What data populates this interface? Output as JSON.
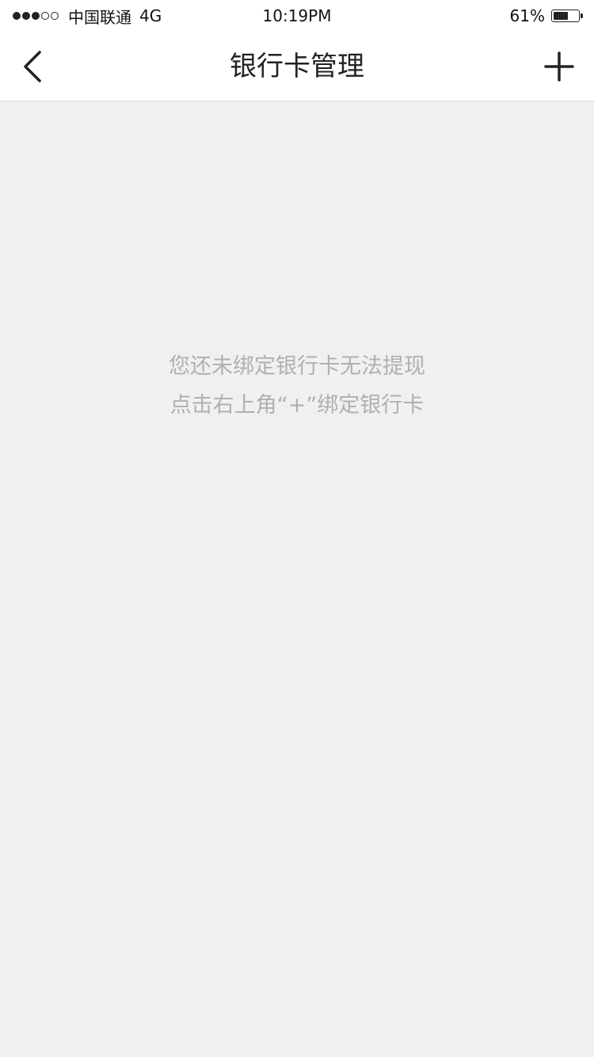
{
  "status_bar": {
    "signal_filled": 3,
    "signal_total": 5,
    "carrier": "中国联通",
    "network": "4G",
    "time": "10:19PM",
    "battery_percent_text": "61%",
    "battery_level": 0.61
  },
  "nav": {
    "title": "银行卡管理",
    "back_icon": "chevron-left-icon",
    "add_icon": "plus-icon"
  },
  "empty_state": {
    "line1": "您还未绑定银行卡无法提现",
    "line2": "点击右上角“+”绑定银行卡"
  },
  "colors": {
    "background": "#f0f0f0",
    "bar_background": "#ffffff",
    "hint_text": "#b0b0b0",
    "title_text": "#222222"
  }
}
